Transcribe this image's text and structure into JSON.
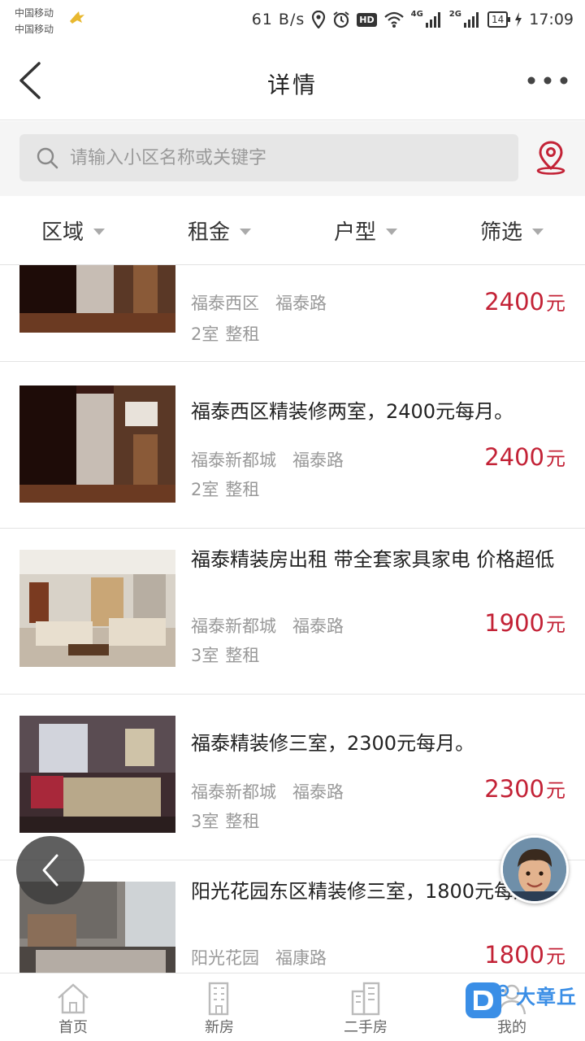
{
  "status_bar": {
    "carrier1": "中国移动",
    "carrier2": "中国移动",
    "speed": "61 B/s",
    "hd": "HD",
    "network1": "4G",
    "network2": "2G",
    "battery": "14",
    "time": "17:09"
  },
  "header": {
    "title": "详情"
  },
  "search": {
    "placeholder": "请输入小区名称或关键字"
  },
  "filters": [
    "区域",
    "租金",
    "户型",
    "筛选"
  ],
  "listings": [
    {
      "title": "",
      "community": "福泰西区",
      "road": "福泰路",
      "rooms": "2室",
      "type": "整租",
      "price": "2400",
      "unit": "元"
    },
    {
      "title": "福泰西区精装修两室，2400元每月。",
      "community": "福泰新都城",
      "road": "福泰路",
      "rooms": "2室",
      "type": "整租",
      "price": "2400",
      "unit": "元"
    },
    {
      "title": "福泰精装房出租 带全套家具家电 价格超低",
      "community": "福泰新都城",
      "road": "福泰路",
      "rooms": "3室",
      "type": "整租",
      "price": "1900",
      "unit": "元"
    },
    {
      "title": "福泰精装修三室，2300元每月。",
      "community": "福泰新都城",
      "road": "福泰路",
      "rooms": "3室",
      "type": "整租",
      "price": "2300",
      "unit": "元"
    },
    {
      "title": "阳光花园东区精装修三室，1800元每月。",
      "community": "阳光花园",
      "road": "福康路",
      "rooms": "3室",
      "type": "整租",
      "price": "1800",
      "unit": "元"
    }
  ],
  "bottom_nav": [
    "首页",
    "新房",
    "二手房",
    "我的"
  ],
  "watermark": "大章丘",
  "colors": {
    "price": "#c32236",
    "accent": "#c32236",
    "watermark": "#3a8ee6"
  }
}
